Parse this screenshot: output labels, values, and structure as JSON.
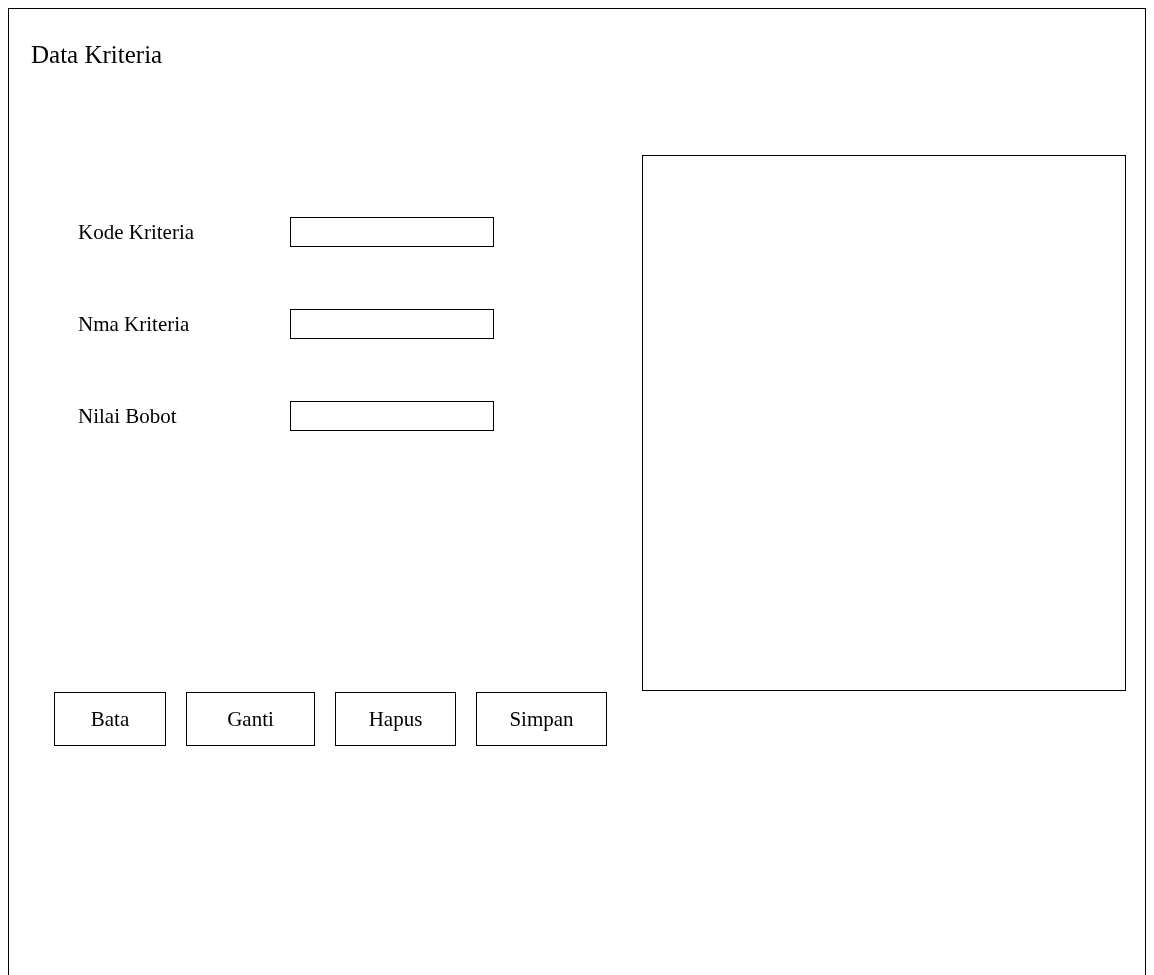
{
  "title": "Data Kriteria",
  "fields": [
    {
      "label": "Kode Kriteria"
    },
    {
      "label": "Nma Kriteria"
    },
    {
      "label": "Nilai Bobot"
    }
  ],
  "buttons": [
    "Bata",
    "Ganti",
    "Hapus",
    "Simpan"
  ]
}
